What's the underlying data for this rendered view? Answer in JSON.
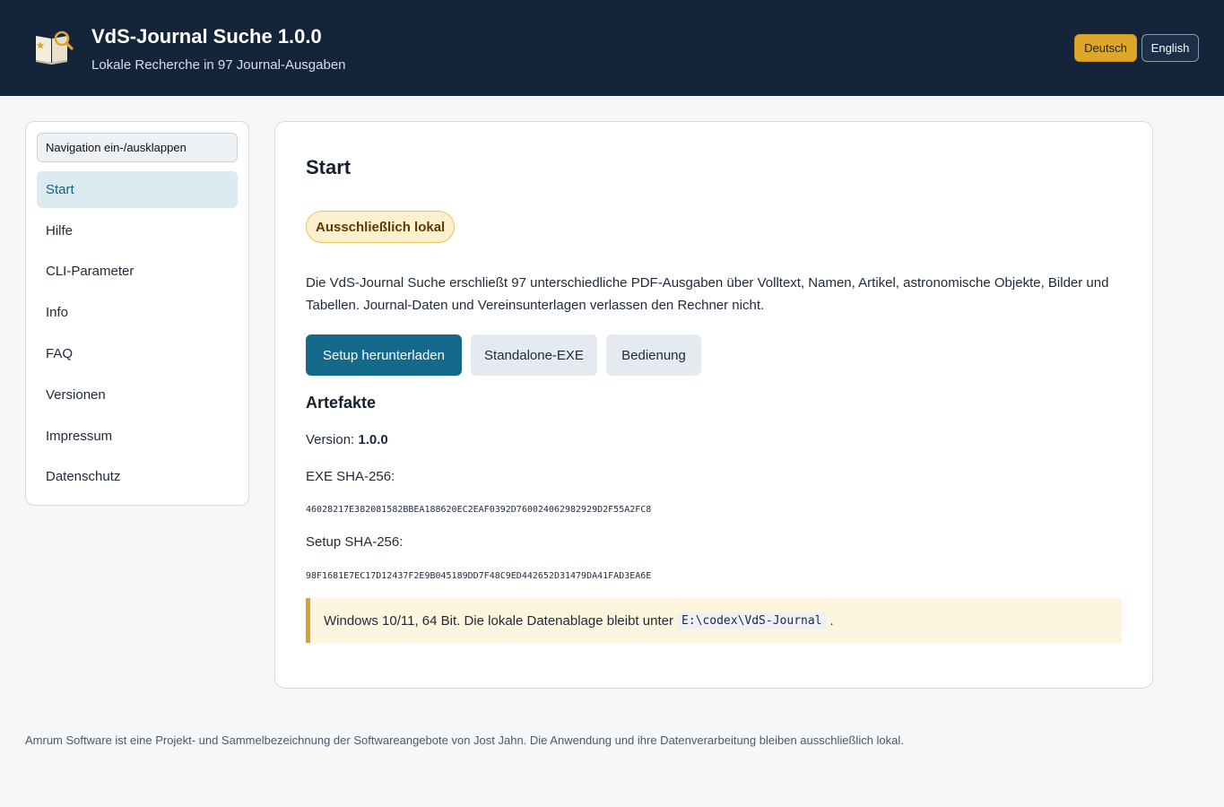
{
  "header": {
    "title": "VdS-Journal Suche 1.0.0",
    "subtitle": "Lokale Recherche in 97 Journal-Ausgaben",
    "lang_de": "Deutsch",
    "lang_en": "English",
    "active_lang_color": "#dea62a"
  },
  "sidebar": {
    "toggle_label": "Navigation ein-/ausklappen",
    "items": [
      {
        "label": "Start",
        "active": true
      },
      {
        "label": "Hilfe"
      },
      {
        "label": "CLI-Parameter"
      },
      {
        "label": "Info"
      },
      {
        "label": "FAQ"
      },
      {
        "label": "Versionen"
      },
      {
        "label": "Impressum"
      },
      {
        "label": "Datenschutz"
      }
    ]
  },
  "main": {
    "title": "Start",
    "badge": "Ausschließlich lokal",
    "intro": "Die VdS-Journal Suche erschließt 97 unterschiedliche PDF-Ausgaben über Volltext, Namen, Artikel, astronomische Objekte, Bilder und Tabellen. Journal-Daten und Vereinsunterlagen verlassen den Rechner nicht.",
    "buttons": {
      "setup": "Setup herunterladen",
      "standalone": "Standalone-EXE",
      "bedienung": "Bedienung"
    },
    "artifacts": {
      "title": "Artefakte",
      "version_label": "Version:",
      "version_value": "1.0.0",
      "exe_label": "EXE SHA-256:",
      "exe_hash": "46028217E382081582BBEA188620EC2EAF0392D760024062982929D2F55A2FC8",
      "setup_label": "Setup SHA-256:",
      "setup_hash": "98F1681E7EC17D12437F2E9B045189DD7F48C9ED442652D31479DA41FAD3EA6E"
    },
    "note": {
      "text": "Windows 10/11, 64 Bit. Die lokale Datenablage bleibt unter",
      "path": "E:\\codex\\VdS-Journal",
      "suffix": "."
    },
    "primary_color": "#15698b"
  },
  "footer": {
    "text": "Amrum Software ist eine Projekt- und Sammelbezeichnung der Softwareangebote von Jost Jahn. Die Anwendung und ihre Datenverarbeitung bleiben ausschließlich lokal."
  }
}
